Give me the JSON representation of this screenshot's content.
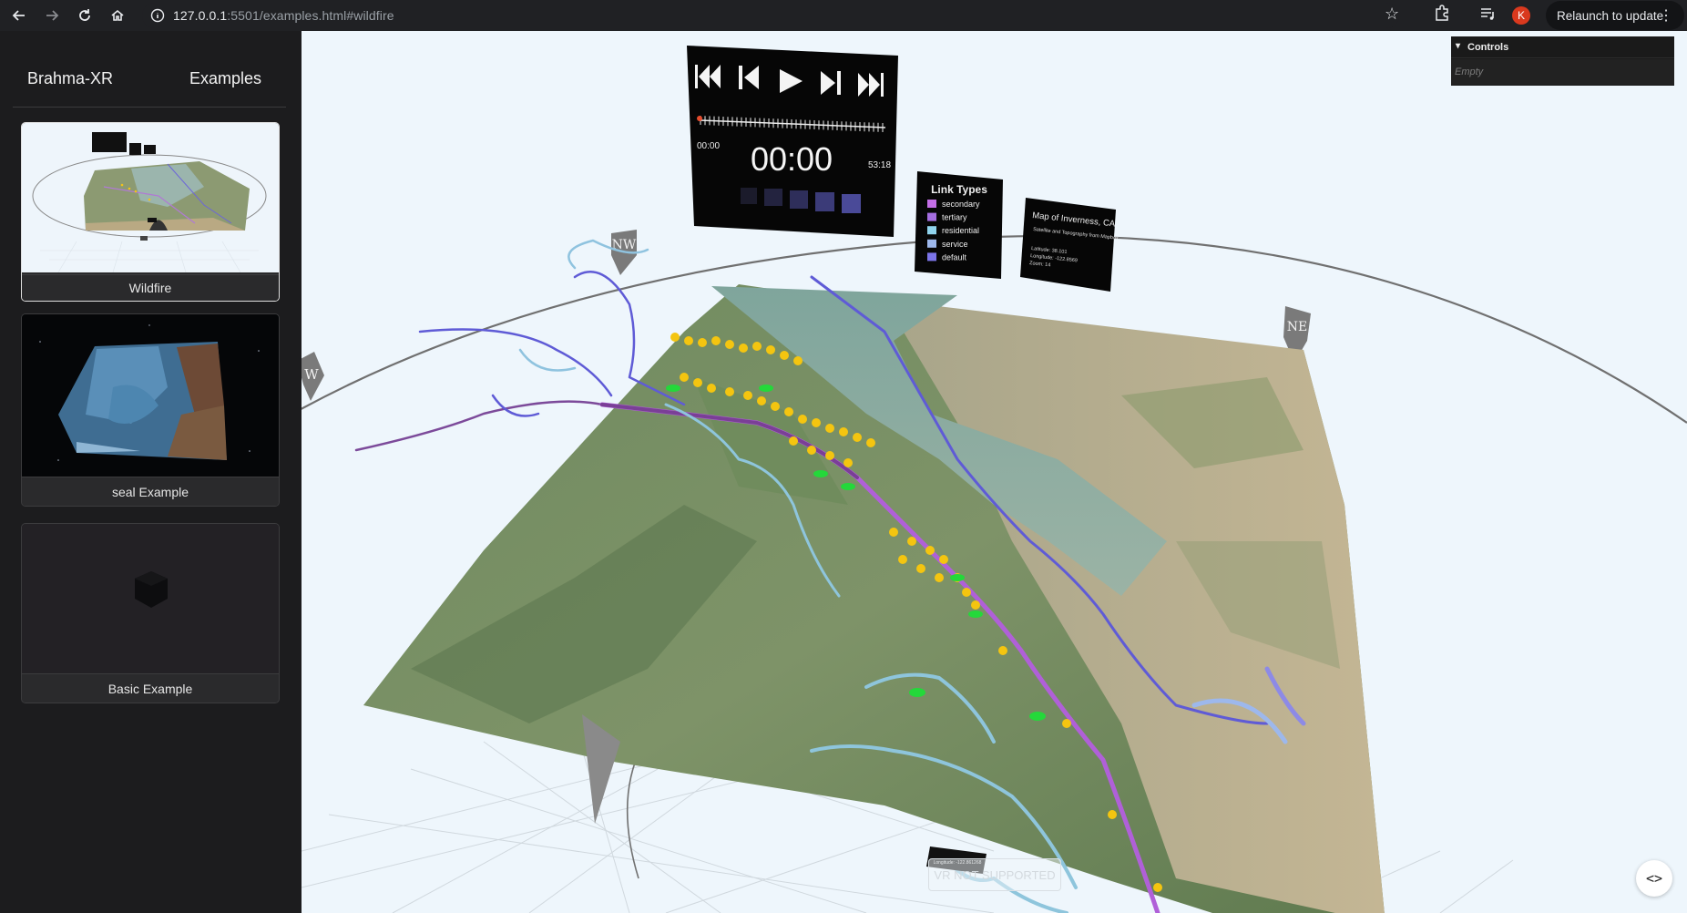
{
  "browser": {
    "url_host": "127.0.0.1",
    "url_path": ":5501/examples.html#wildfire",
    "relaunch_label": "Relaunch to update",
    "profile_initial": "K",
    "icons": [
      "back-icon",
      "forward-icon",
      "reload-icon",
      "home-icon",
      "site-info-icon",
      "bookmark-star-icon",
      "extensions-icon",
      "media-controls-icon",
      "menu-dots-icon"
    ]
  },
  "sidebar": {
    "brand": "Brahma-XR",
    "examples_label": "Examples",
    "cards": [
      {
        "label": "Wildfire",
        "active": true
      },
      {
        "label": "seal Example",
        "active": false
      },
      {
        "label": "Basic Example",
        "active": false
      }
    ]
  },
  "controls": {
    "title": "Controls",
    "empty_text": "Empty"
  },
  "player": {
    "current_time": "00:00",
    "start_time": "00:00",
    "end_time": "53:18"
  },
  "legend": {
    "title": "Link Types",
    "items": [
      {
        "label": "secondary",
        "color": "#c36ee6"
      },
      {
        "label": "tertiary",
        "color": "#a46ee0"
      },
      {
        "label": "residential",
        "color": "#8fd3ec"
      },
      {
        "label": "service",
        "color": "#9db8ec"
      },
      {
        "label": "default",
        "color": "#7b74e8"
      }
    ]
  },
  "map_info": {
    "title": "Map of Inverness, CA",
    "subtitle": "Satellite and Topography from Mapbox",
    "latitude": "Latitude: 38.101",
    "longitude": "Longitude: -122.8569",
    "zoom": "Zoom: 14"
  },
  "compass": {
    "nw": "NW",
    "w": "W",
    "ne": "NE"
  },
  "coord_tag": "Longitude: -122.861268",
  "vr_button": "VR NOT SUPPORTED",
  "code_toggle": "<>"
}
